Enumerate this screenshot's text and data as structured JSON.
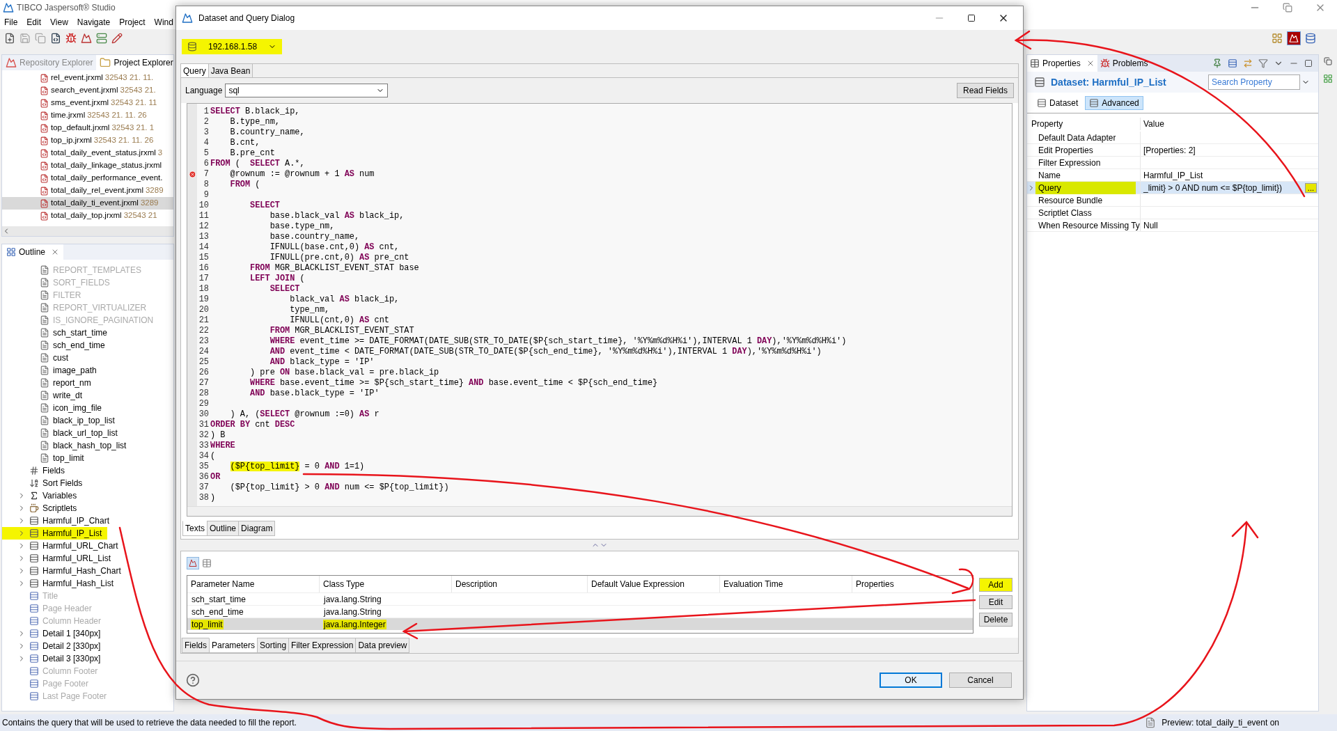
{
  "app": {
    "title": "TIBCO Jaspersoft® Studio",
    "menu": [
      "File",
      "Edit",
      "View",
      "Navigate",
      "Project",
      "Wind"
    ]
  },
  "explorer": {
    "tabs": [
      {
        "label": "Repository Explorer",
        "selected": false
      },
      {
        "label": "Project Explorer",
        "selected": true
      }
    ],
    "files": [
      {
        "name": "rel_event.jrxml",
        "meta": "32543  21. 11.",
        "selected": false
      },
      {
        "name": "search_event.jrxml",
        "meta": "32543  21.",
        "selected": false
      },
      {
        "name": "sms_event.jrxml",
        "meta": "32543  21. 11",
        "selected": false
      },
      {
        "name": "time.jrxml",
        "meta": "32543  21. 11. 26",
        "selected": false
      },
      {
        "name": "top_default.jrxml",
        "meta": "32543  21. 1",
        "selected": false
      },
      {
        "name": "top_ip.jrxml",
        "meta": "32543  21. 11. 26",
        "selected": false
      },
      {
        "name": "total_daily_event_status.jrxml",
        "meta": "3",
        "selected": false
      },
      {
        "name": "total_daily_linkage_status.jrxml",
        "selected": false
      },
      {
        "name": "total_daily_performance_event.",
        "selected": false
      },
      {
        "name": "total_daily_rel_event.jrxml",
        "meta": "3289",
        "selected": false
      },
      {
        "name": "total_daily_ti_event.jrxml",
        "meta": "3289",
        "selected": true
      },
      {
        "name": "total_daily_top.jrxml",
        "meta": "32543  21",
        "selected": false
      }
    ]
  },
  "outline": {
    "title": "Outline",
    "parameters": [
      {
        "label": "REPORT_TEMPLATES",
        "disabled": true
      },
      {
        "label": "SORT_FIELDS",
        "disabled": true
      },
      {
        "label": "FILTER",
        "disabled": true
      },
      {
        "label": "REPORT_VIRTUALIZER",
        "disabled": true
      },
      {
        "label": "IS_IGNORE_PAGINATION",
        "disabled": true
      },
      {
        "label": "sch_start_time",
        "disabled": false
      },
      {
        "label": "sch_end_time",
        "disabled": false
      },
      {
        "label": "cust",
        "disabled": false
      },
      {
        "label": "image_path",
        "disabled": false
      },
      {
        "label": "report_nm",
        "disabled": false
      },
      {
        "label": "write_dt",
        "disabled": false
      },
      {
        "label": "icon_img_file",
        "disabled": false
      },
      {
        "label": "black_ip_top_list",
        "disabled": false
      },
      {
        "label": "black_url_top_list",
        "disabled": false
      },
      {
        "label": "black_hash_top_list",
        "disabled": false
      },
      {
        "label": "top_limit",
        "disabled": false
      }
    ],
    "items": [
      {
        "label": "Fields",
        "kind": "fields",
        "expandable": false,
        "disabled": false,
        "highlighted": false
      },
      {
        "label": "Sort Fields",
        "kind": "sort",
        "expandable": false,
        "disabled": false,
        "highlighted": false
      },
      {
        "label": "Variables",
        "kind": "variables",
        "expandable": true,
        "disabled": false,
        "highlighted": false
      },
      {
        "label": "Scriptlets",
        "kind": "scriptlets",
        "expandable": true,
        "disabled": false,
        "highlighted": false
      },
      {
        "label": "Harmful_IP_Chart",
        "kind": "dataset",
        "expandable": true,
        "disabled": false,
        "highlighted": false
      },
      {
        "label": "Harmful_IP_List",
        "kind": "dataset",
        "expandable": true,
        "disabled": false,
        "highlighted": true
      },
      {
        "label": "Harmful_URL_Chart",
        "kind": "dataset",
        "expandable": true,
        "disabled": false,
        "highlighted": false
      },
      {
        "label": "Harmful_URL_List",
        "kind": "dataset",
        "expandable": true,
        "disabled": false,
        "highlighted": false
      },
      {
        "label": "Harmful_Hash_Chart",
        "kind": "dataset",
        "expandable": true,
        "disabled": false,
        "highlighted": false
      },
      {
        "label": "Harmful_Hash_List",
        "kind": "dataset",
        "expandable": true,
        "disabled": false,
        "highlighted": false
      },
      {
        "label": "Title",
        "kind": "band",
        "expandable": false,
        "disabled": true,
        "highlighted": false
      },
      {
        "label": "Page Header",
        "kind": "band",
        "expandable": false,
        "disabled": true,
        "highlighted": false
      },
      {
        "label": "Column Header",
        "kind": "band",
        "expandable": false,
        "disabled": true,
        "highlighted": false
      },
      {
        "label": "Detail 1 [340px]",
        "kind": "band",
        "expandable": true,
        "disabled": false,
        "highlighted": false
      },
      {
        "label": "Detail 2 [330px]",
        "kind": "band",
        "expandable": true,
        "disabled": false,
        "highlighted": false
      },
      {
        "label": "Detail 3 [330px]",
        "kind": "band",
        "expandable": true,
        "disabled": false,
        "highlighted": false
      },
      {
        "label": "Column Footer",
        "kind": "band",
        "expandable": false,
        "disabled": true,
        "highlighted": false
      },
      {
        "label": "Page Footer",
        "kind": "band",
        "expandable": false,
        "disabled": true,
        "highlighted": false
      },
      {
        "label": "Last Page Footer",
        "kind": "band",
        "expandable": false,
        "disabled": true,
        "highlighted": false
      }
    ]
  },
  "dialog": {
    "title": "Dataset and Query Dialog",
    "data_adapter": {
      "label": "192.168.1.58",
      "highlighted": true
    },
    "tabs": [
      {
        "label": "Query",
        "selected": true
      },
      {
        "label": "Java Bean",
        "selected": false
      }
    ],
    "language": {
      "label": "Language",
      "value": "sql"
    },
    "read_fields": "Read Fields",
    "code": [
      {
        "n": "1",
        "error": false,
        "text": "**SELECT** B.black_ip,"
      },
      {
        "n": "2",
        "error": false,
        "text": "    B.type_nm,"
      },
      {
        "n": "3",
        "error": false,
        "text": "    B.country_name,"
      },
      {
        "n": "4",
        "error": false,
        "text": "    B.cnt,"
      },
      {
        "n": "5",
        "error": false,
        "text": "    B.pre_cnt"
      },
      {
        "n": "6",
        "error": false,
        "text": "**FROM** (  **SELECT** A.*,"
      },
      {
        "n": "7",
        "error": true,
        "text": "    @rownum := @rownum + 1 **AS** num"
      },
      {
        "n": "8",
        "error": false,
        "text": "    **FROM** ("
      },
      {
        "n": "9",
        "error": false
      },
      {
        "n": "10",
        "error": false,
        "text": "        **SELECT**"
      },
      {
        "n": "11",
        "error": false,
        "text": "            base.black_val **AS** black_ip,"
      },
      {
        "n": "12",
        "error": false,
        "text": "            base.type_nm,"
      },
      {
        "n": "13",
        "error": false,
        "text": "            base.country_name,"
      },
      {
        "n": "14",
        "error": false,
        "text": "            IFNULL(base.cnt,0) **AS** cnt,"
      },
      {
        "n": "15",
        "error": false,
        "text": "            IFNULL(pre.cnt,0) **AS** pre_cnt"
      },
      {
        "n": "16",
        "error": false,
        "text": "        **FROM** MGR_BLACKLIST_EVENT_STAT base"
      },
      {
        "n": "17",
        "error": false,
        "text": "        **LEFT JOIN** ("
      },
      {
        "n": "18",
        "error": false,
        "text": "            **SELECT**"
      },
      {
        "n": "19",
        "error": false,
        "text": "                black_val **AS** black_ip,"
      },
      {
        "n": "20",
        "error": false,
        "text": "                type_nm,"
      },
      {
        "n": "21",
        "error": false,
        "text": "                IFNULL(cnt,0) **AS** cnt"
      },
      {
        "n": "22",
        "error": false,
        "text": "            **FROM** MGR_BLACKLIST_EVENT_STAT"
      },
      {
        "n": "23",
        "error": false,
        "text": "            **WHERE** event_time >= DATE_FORMAT(DATE_SUB(STR_TO_DATE($P{sch_start_time}, '%Y%m%d%H%i'),INTERVAL 1 **DAY**),'%Y%m%d%H%i')"
      },
      {
        "n": "24",
        "error": false,
        "text": "            **AND** event_time < DATE_FORMAT(DATE_SUB(STR_TO_DATE($P{sch_end_time}, '%Y%m%d%H%i'),INTERVAL 1 **DAY**),'%Y%m%d%H%i')"
      },
      {
        "n": "25",
        "error": false,
        "text": "            **AND** black_type = 'IP'"
      },
      {
        "n": "26",
        "error": false,
        "text": "        ) pre **ON** base.black_val = pre.black_ip"
      },
      {
        "n": "27",
        "error": false,
        "text": "        **WHERE** base.event_time >= $P{sch_start_time} **AND** base.event_time < $P{sch_end_time}"
      },
      {
        "n": "28",
        "error": false,
        "text": "        **AND** base.black_type = 'IP'"
      },
      {
        "n": "29",
        "error": false
      },
      {
        "n": "30",
        "error": false,
        "text": "    ) A, (**SELECT** @rownum :=0) **AS** r"
      },
      {
        "n": "31",
        "error": false,
        "text": "**ORDER BY** cnt **DESC**"
      },
      {
        "n": "32",
        "error": false,
        "text": ") B"
      },
      {
        "n": "33",
        "error": false,
        "text": "**WHERE**"
      },
      {
        "n": "34",
        "error": false,
        "text": "("
      },
      {
        "n": "35",
        "error": false,
        "highlight": "($P{top_limit}",
        "text": " = 0 **AND** 1=1)"
      },
      {
        "n": "36",
        "error": false,
        "text": "**OR**"
      },
      {
        "n": "37",
        "error": false,
        "text": "    ($P{top_limit} > 0 **AND** num <= $P{top_limit})"
      },
      {
        "n": "38",
        "error": false,
        "text": ")"
      }
    ],
    "editor_tabs": [
      {
        "label": "Texts",
        "selected": true
      },
      {
        "label": "Outline",
        "selected": false
      },
      {
        "label": "Diagram",
        "selected": false
      }
    ],
    "parameters": {
      "columns": [
        "Parameter Name",
        "Class Type",
        "Description",
        "Default Value Expression",
        "Evaluation Time",
        "Properties"
      ],
      "rows": [
        {
          "name": "sch_start_time",
          "class_type": "java.lang.String",
          "selected": false,
          "highlighted": false
        },
        {
          "name": "sch_end_time",
          "class_type": "java.lang.String",
          "selected": false,
          "highlighted": false
        },
        {
          "name": "top_limit",
          "class_type": "java.lang.Integer",
          "selected": true,
          "highlighted": true
        }
      ]
    },
    "buttons": [
      {
        "label": "Add",
        "highlighted": true
      },
      {
        "label": "Edit",
        "highlighted": false
      },
      {
        "label": "Delete",
        "highlighted": false
      }
    ],
    "bottom_tabs": [
      {
        "label": "Fields",
        "selected": false
      },
      {
        "label": "Parameters",
        "selected": true
      },
      {
        "label": "Sorting",
        "selected": false
      },
      {
        "label": "Filter Expression",
        "selected": false
      },
      {
        "label": "Data preview",
        "selected": false
      }
    ],
    "ok": "OK",
    "cancel": "Cancel"
  },
  "properties": {
    "tabs": [
      {
        "label": "Properties",
        "selected": true
      },
      {
        "label": "Problems",
        "selected": false
      }
    ],
    "heading": "Dataset: Harmful_IP_List",
    "search": {
      "placeholder": "Search Property"
    },
    "subtabs": [
      {
        "label": "Dataset",
        "selected": false
      },
      {
        "label": "Advanced",
        "selected": true
      }
    ],
    "columns": [
      "Property",
      "Value"
    ],
    "rows": [
      {
        "property": "Default Data Adapter",
        "value": "",
        "selected": false,
        "expandable": false,
        "highlighted": false
      },
      {
        "property": "Edit Properties",
        "value": "[Properties: 2]",
        "selected": false,
        "expandable": false,
        "highlighted": false
      },
      {
        "property": "Filter Expression",
        "value": "",
        "selected": false,
        "expandable": false,
        "highlighted": false
      },
      {
        "property": "Name",
        "value": "Harmful_IP_List",
        "selected": false,
        "expandable": false,
        "highlighted": false
      },
      {
        "property": "Query",
        "value": "_limit} > 0 AND num <= $P{top_limit})",
        "button": "...",
        "selected": true,
        "expandable": true,
        "highlighted": true
      },
      {
        "property": "Resource Bundle",
        "value": "",
        "selected": false,
        "expandable": false,
        "highlighted": false
      },
      {
        "property": "Scriptlet Class",
        "value": "",
        "selected": false,
        "expandable": false,
        "highlighted": false
      },
      {
        "property": "When Resource Missing Ty",
        "value": "Null",
        "selected": false,
        "expandable": false,
        "highlighted": false
      }
    ]
  },
  "status_bar": {
    "message": "Contains the query that will be used to retrieve the data needed to fill the report.",
    "preview": "Preview: total_daily_ti_event on"
  }
}
